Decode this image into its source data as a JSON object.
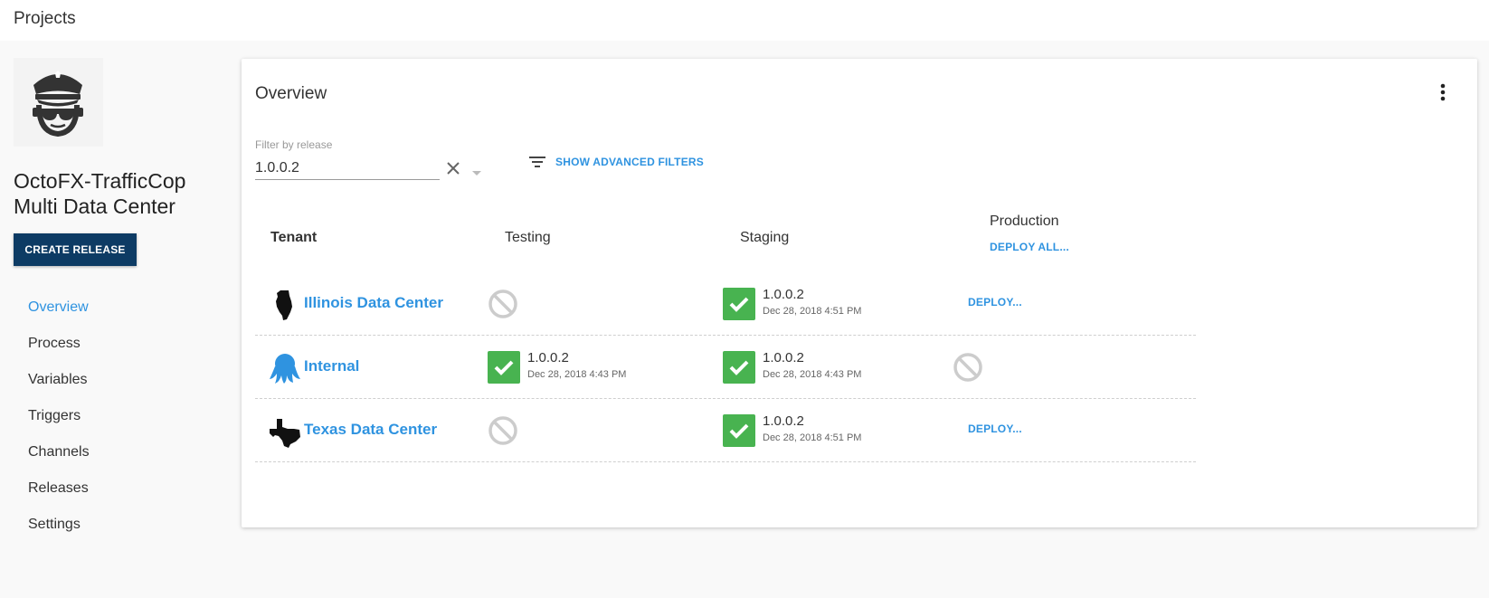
{
  "header": {
    "title": "Projects"
  },
  "project": {
    "name": "OctoFX-TrafficCop Multi Data Center",
    "logo_icon": "police-officer-icon",
    "create_release_label": "CREATE RELEASE"
  },
  "nav": {
    "items": [
      {
        "label": "Overview",
        "active": true
      },
      {
        "label": "Process",
        "active": false
      },
      {
        "label": "Variables",
        "active": false
      },
      {
        "label": "Triggers",
        "active": false
      },
      {
        "label": "Channels",
        "active": false
      },
      {
        "label": "Releases",
        "active": false
      },
      {
        "label": "Settings",
        "active": false
      }
    ]
  },
  "overview": {
    "title": "Overview",
    "filter": {
      "label": "Filter by release",
      "value": "1.0.0.2",
      "advanced_filters_label": "SHOW ADVANCED FILTERS"
    },
    "columns": {
      "tenant": "Tenant",
      "testing": "Testing",
      "staging": "Staging",
      "production": "Production",
      "deploy_all_label": "DEPLOY ALL..."
    },
    "rows": [
      {
        "tenant": "Illinois Data Center",
        "icon": "illinois-state-icon",
        "testing": {
          "status": "skipped"
        },
        "staging": {
          "status": "success",
          "version": "1.0.0.2",
          "date": "Dec 28, 2018 4:51 PM"
        },
        "production": {
          "status": "deploy",
          "label": "DEPLOY..."
        }
      },
      {
        "tenant": "Internal",
        "icon": "octopus-icon",
        "testing": {
          "status": "success",
          "version": "1.0.0.2",
          "date": "Dec 28, 2018 4:43 PM"
        },
        "staging": {
          "status": "success",
          "version": "1.0.0.2",
          "date": "Dec 28, 2018 4:43 PM"
        },
        "production": {
          "status": "skipped"
        }
      },
      {
        "tenant": "Texas Data Center",
        "icon": "texas-state-icon",
        "testing": {
          "status": "skipped"
        },
        "staging": {
          "status": "success",
          "version": "1.0.0.2",
          "date": "Dec 28, 2018 4:51 PM"
        },
        "production": {
          "status": "deploy",
          "label": "DEPLOY..."
        }
      }
    ]
  },
  "colors": {
    "accent": "#2f93e0",
    "primary_button": "#0d3b64",
    "success": "#48b350",
    "skipped": "#cccccc"
  }
}
